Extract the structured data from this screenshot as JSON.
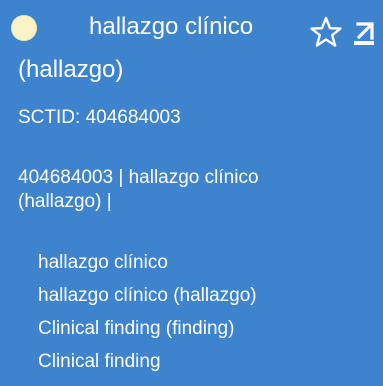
{
  "concept": {
    "title": "hallazgo clínico (hallazgo)",
    "title_line1": "hallazgo clínico",
    "title_line2": "(hallazgo)",
    "sctid_label": "SCTID: 404684003",
    "fsn_line1": "404684003 | hallazgo clínico",
    "fsn_line2": "(hallazgo) |",
    "definition_status_color": "#fbf3c8",
    "panel_color": "#3d83cd"
  },
  "actions": {
    "favorite_icon": "star-outline-icon",
    "export_icon": "export-arrow-icon"
  },
  "descriptions": [
    "hallazgo clínico",
    "hallazgo clínico (hallazgo)",
    "Clinical finding (finding)",
    "Clinical finding"
  ]
}
